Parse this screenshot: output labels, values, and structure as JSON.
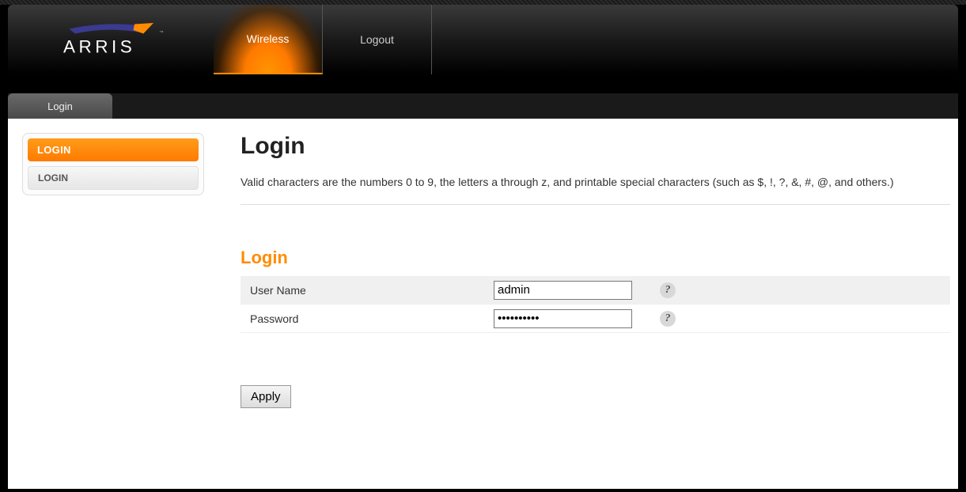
{
  "brand": "ARRIS",
  "nav": {
    "wireless": "Wireless",
    "logout": "Logout"
  },
  "subnav": {
    "login": "Login"
  },
  "sidebar": {
    "heading": "LOGIN",
    "item1": "LOGIN"
  },
  "page": {
    "title": "Login",
    "description": "Valid characters are the numbers 0 to 9, the letters a through z, and printable special characters (such as $, !, ?, &, #, @, and others.)",
    "section_title": "Login"
  },
  "form": {
    "username_label": "User Name",
    "username_value": "admin",
    "password_label": "Password",
    "password_value": "••••••••••",
    "apply_label": "Apply"
  }
}
